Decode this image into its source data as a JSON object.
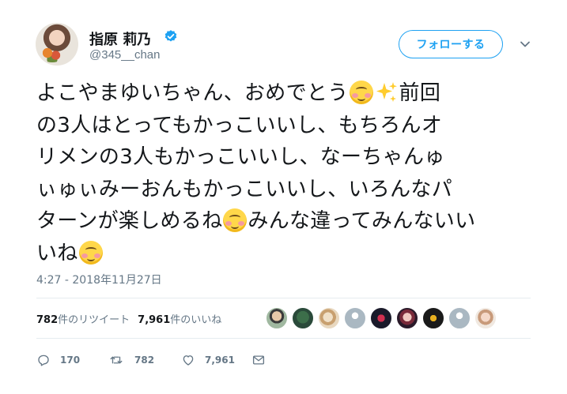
{
  "user": {
    "display_name": "指原 莉乃",
    "handle": "@345__chan",
    "avatar_icon": "user-avatar",
    "verified_icon": "verified-badge-icon",
    "verified_color": "#1da1f2"
  },
  "follow_button": {
    "label": "フォローする"
  },
  "menu_icon": "chevron-down-icon",
  "tweet": {
    "lines": [
      "よこやまゆいちゃん、おめでとう",
      "の3人はとってもかっこいいし、もちろんオ",
      "リメンの3人もかっこいいし、なーちゃんゅ",
      "ぃゅぃみーおんもかっこいいし、いろんなパ",
      "ターンが楽しめるね",
      "いね"
    ],
    "line1_tail": "前回",
    "line5_tail": "みんな違ってみんないい",
    "emojis": [
      "smiling-face-icon",
      "sparkles-icon",
      "smiling-face-icon",
      "smiling-face-icon"
    ]
  },
  "timestamp": "4:27 - 2018年11月27日",
  "stats": {
    "retweets_count": "782",
    "retweets_label": "件のリツイート",
    "likes_count": "7,961",
    "likes_label": "件のいいね",
    "liker_avatars": 9
  },
  "actions": {
    "reply_count": "170",
    "retweet_count": "782",
    "like_count": "7,961"
  },
  "colors": {
    "text": "#14171a",
    "secondary": "#657786",
    "accent": "#1da1f2",
    "divider": "#e6ecf0"
  }
}
